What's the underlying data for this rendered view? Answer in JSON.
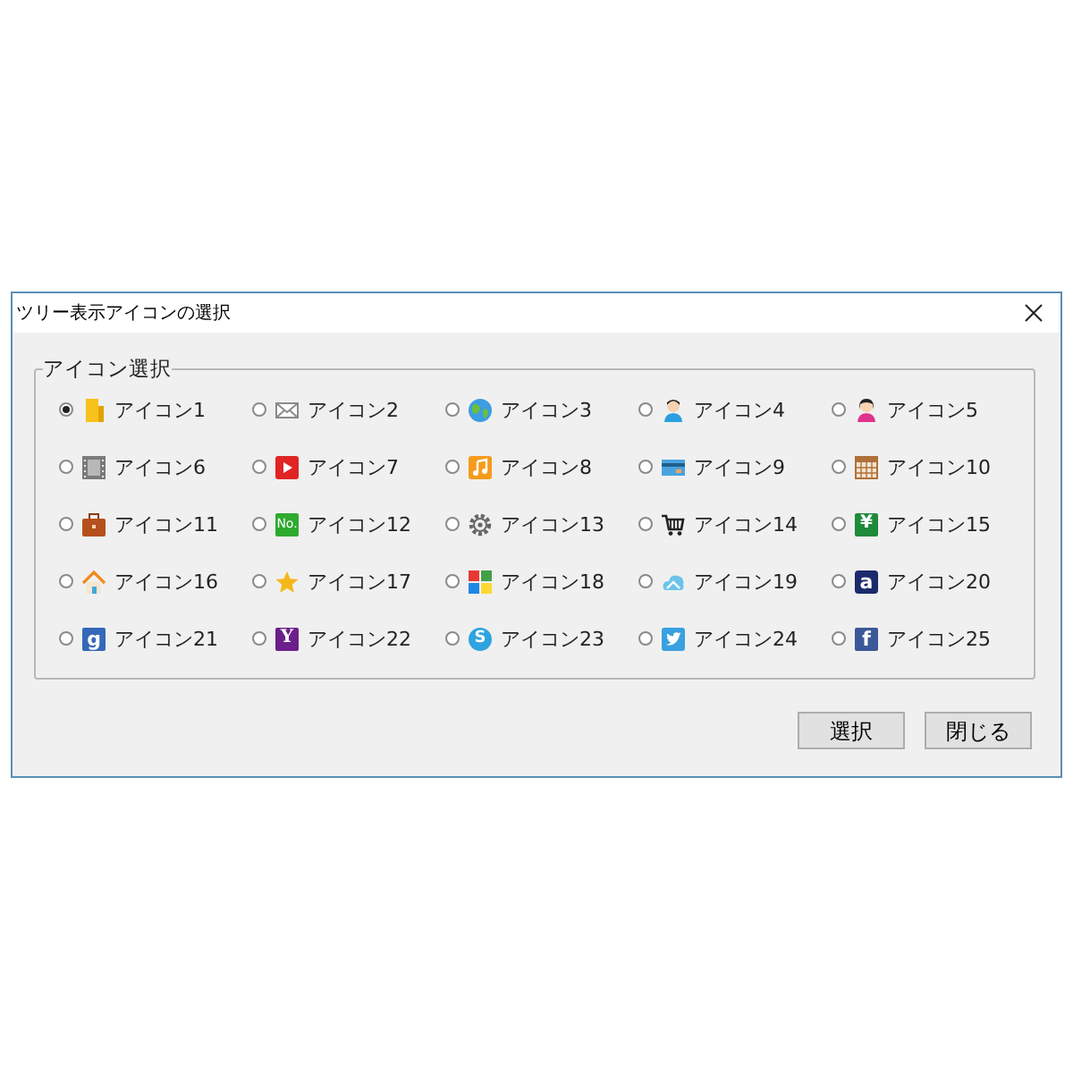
{
  "window": {
    "title": "ツリー表示アイコンの選択"
  },
  "group": {
    "legend": "アイコン選択"
  },
  "options": [
    {
      "label": "アイコン1",
      "selected": true
    },
    {
      "label": "アイコン2",
      "selected": false
    },
    {
      "label": "アイコン3",
      "selected": false
    },
    {
      "label": "アイコン4",
      "selected": false
    },
    {
      "label": "アイコン5",
      "selected": false
    },
    {
      "label": "アイコン6",
      "selected": false
    },
    {
      "label": "アイコン7",
      "selected": false
    },
    {
      "label": "アイコン8",
      "selected": false
    },
    {
      "label": "アイコン9",
      "selected": false
    },
    {
      "label": "アイコン10",
      "selected": false
    },
    {
      "label": "アイコン11",
      "selected": false
    },
    {
      "label": "アイコン12",
      "selected": false,
      "icon_text": "No."
    },
    {
      "label": "アイコン13",
      "selected": false
    },
    {
      "label": "アイコン14",
      "selected": false
    },
    {
      "label": "アイコン15",
      "selected": false,
      "icon_text": "¥"
    },
    {
      "label": "アイコン16",
      "selected": false
    },
    {
      "label": "アイコン17",
      "selected": false
    },
    {
      "label": "アイコン18",
      "selected": false
    },
    {
      "label": "アイコン19",
      "selected": false
    },
    {
      "label": "アイコン20",
      "selected": false,
      "icon_text": "a"
    },
    {
      "label": "アイコン21",
      "selected": false,
      "icon_text": "g"
    },
    {
      "label": "アイコン22",
      "selected": false,
      "icon_text": "Y"
    },
    {
      "label": "アイコン23",
      "selected": false,
      "icon_text": "S"
    },
    {
      "label": "アイコン24",
      "selected": false
    },
    {
      "label": "アイコン25",
      "selected": false,
      "icon_text": "f"
    }
  ],
  "buttons": [
    "選択",
    "閉じる"
  ]
}
